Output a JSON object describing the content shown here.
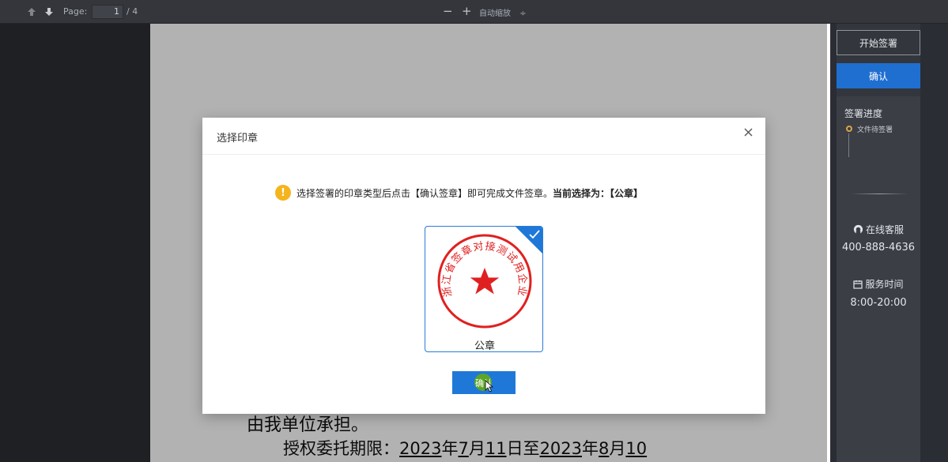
{
  "toolbar": {
    "page_label": "Page:",
    "page_value": "1",
    "page_total": "/ 4",
    "zoom_out": "−",
    "zoom_in": "+",
    "zoom_select": "自动缩放",
    "zoom_select_arrow": "÷"
  },
  "document": {
    "clause_tail": "由我单位承担。",
    "auth_prefix": "授权委托期限：",
    "year1": "2023",
    "nian1": "年",
    "month1": "7",
    "yue1": "月",
    "day1": "11",
    "ri_zhi": "日至",
    "year2": "2023",
    "nian2": "年",
    "month2": "8",
    "yue2": "月",
    "day2": "10"
  },
  "modal": {
    "title": "选择印章",
    "notice_text": "选择签署的印章类型后点击【确认签章】即可完成文件签章。",
    "notice_current": "当前选择为：【公章】",
    "seal_name": "公章",
    "seal_ring_text": "浙江省签章对接测试用企业",
    "confirm_label": "确认"
  },
  "side_panel": {
    "start_sign": "开始签署",
    "confirm": "确认",
    "progress_title": "签署进度",
    "progress_item": "文件待签署",
    "online_service": "在线客服",
    "phone": "400-888-4636",
    "service_hours_label": "服务时间",
    "service_hours": "8:00-20:00"
  },
  "colors": {
    "accent": "#1f78d8",
    "warning": "#f5b41c",
    "seal_red": "#e02020",
    "progress_dot": "#d9a44a"
  }
}
